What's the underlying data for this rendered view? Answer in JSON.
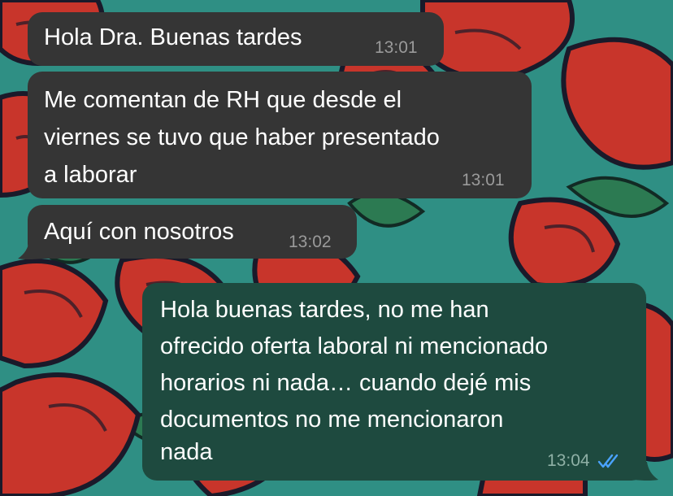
{
  "colors": {
    "wallpaper_teal": "#2f8f84",
    "rose_red": "#c8352b",
    "leaf_green": "#2c7a52",
    "incoming_bubble": "#353535",
    "outgoing_bubble": "#1e4a3f",
    "read_tick": "#4aa3ff"
  },
  "messages": [
    {
      "direction": "incoming",
      "lines": [
        "Hola Dra. Buenas tardes"
      ],
      "time": "13:01"
    },
    {
      "direction": "incoming",
      "lines": [
        "Me comentan de RH que desde el",
        "viernes se tuvo que haber presentado",
        "a laborar"
      ],
      "time": "13:01"
    },
    {
      "direction": "incoming",
      "lines": [
        "Aquí con nosotros"
      ],
      "time": "13:02"
    },
    {
      "direction": "outgoing",
      "lines": [
        "Hola buenas tardes, no me han",
        "ofrecido oferta laboral ni mencionado",
        "horarios ni nada… cuando dejé mis",
        "documentos no me mencionaron",
        "nada"
      ],
      "time": "13:04",
      "status_icon": "double-check-read-icon"
    }
  ]
}
